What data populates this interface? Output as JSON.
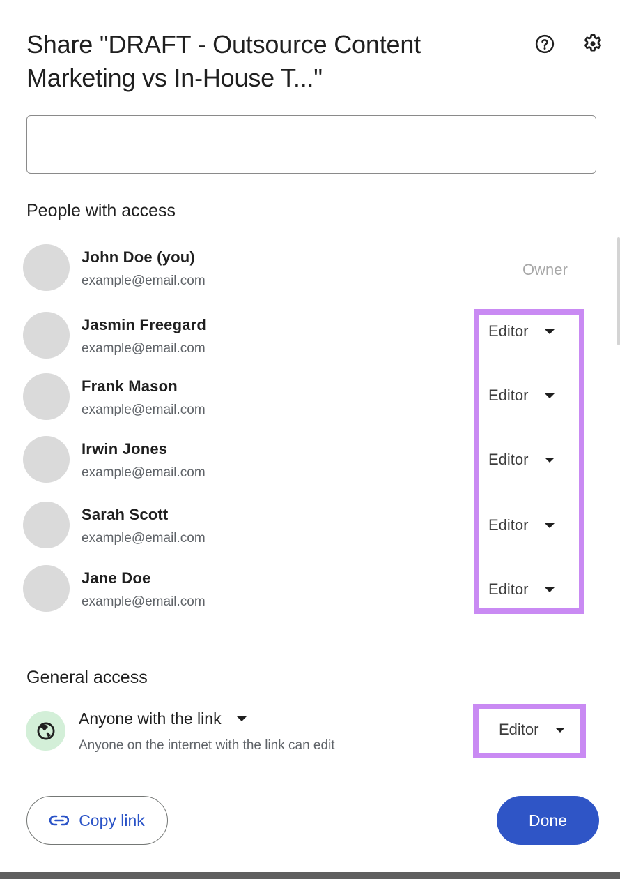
{
  "dialog": {
    "title": "Share \"DRAFT - Outsource Content Marketing vs In-House T...\"",
    "icons": {
      "help": "help-circle-icon",
      "settings": "gear-icon"
    }
  },
  "add_people": {
    "value": "",
    "placeholder": ""
  },
  "people_section": {
    "heading": "People with access",
    "people": [
      {
        "name": "John Doe (you)",
        "email": "example@email.com",
        "role": "Owner",
        "editable": false
      },
      {
        "name": "Jasmin Freegard",
        "email": "example@email.com",
        "role": "Editor",
        "editable": true
      },
      {
        "name": "Frank Mason",
        "email": "example@email.com",
        "role": "Editor",
        "editable": true
      },
      {
        "name": "Irwin Jones",
        "email": "example@email.com",
        "role": "Editor",
        "editable": true
      },
      {
        "name": "Sarah Scott",
        "email": "example@email.com",
        "role": "Editor",
        "editable": true
      },
      {
        "name": "Jane Doe",
        "email": "example@email.com",
        "role": "Editor",
        "editable": true
      }
    ]
  },
  "general_access": {
    "heading": "General access",
    "scope": "Anyone with the link",
    "description": "Anyone on the internet with the link can edit",
    "role": "Editor",
    "icon": "globe-icon"
  },
  "footer": {
    "copy_link_label": "Copy link",
    "done_label": "Done"
  },
  "colors": {
    "highlight": "#c98af3",
    "primary": "#2f55c6",
    "link_text": "#2a53c7",
    "globe_badge": "#d3efd8",
    "avatar_placeholder": "#dadada"
  }
}
